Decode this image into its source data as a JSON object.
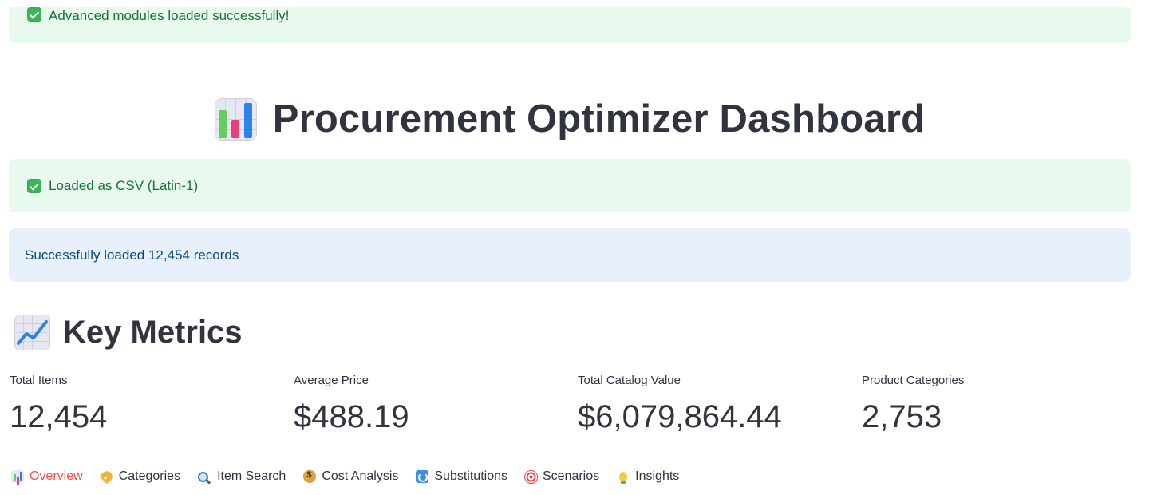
{
  "alerts": {
    "modules": "Advanced modules loaded successfully!",
    "csv": "Loaded as CSV (Latin-1)",
    "records": "Successfully loaded 12,454 records"
  },
  "title": "Procurement Optimizer Dashboard",
  "key_metrics": {
    "heading": "Key Metrics",
    "items": [
      {
        "label": "Total Items",
        "value": "12,454"
      },
      {
        "label": "Average Price",
        "value": "$488.19"
      },
      {
        "label": "Total Catalog Value",
        "value": "$6,079,864.44"
      },
      {
        "label": "Product Categories",
        "value": "2,753"
      }
    ]
  },
  "tabs": [
    {
      "label": "Overview",
      "icon": "bar-chart-icon",
      "active": true
    },
    {
      "label": "Categories",
      "icon": "tag-icon",
      "active": false
    },
    {
      "label": "Item Search",
      "icon": "magnifier-icon",
      "active": false
    },
    {
      "label": "Cost Analysis",
      "icon": "money-bag-icon",
      "active": false
    },
    {
      "label": "Substitutions",
      "icon": "refresh-icon",
      "active": false
    },
    {
      "label": "Scenarios",
      "icon": "target-icon",
      "active": false
    },
    {
      "label": "Insights",
      "icon": "lightbulb-icon",
      "active": false
    }
  ],
  "colors": {
    "success_bg": "#e8f9ee",
    "success_text": "#177233",
    "info_bg": "#e8f1fb",
    "info_text": "#0b4a7a",
    "active_tab": "#ff4b4b",
    "text": "#31333f"
  }
}
